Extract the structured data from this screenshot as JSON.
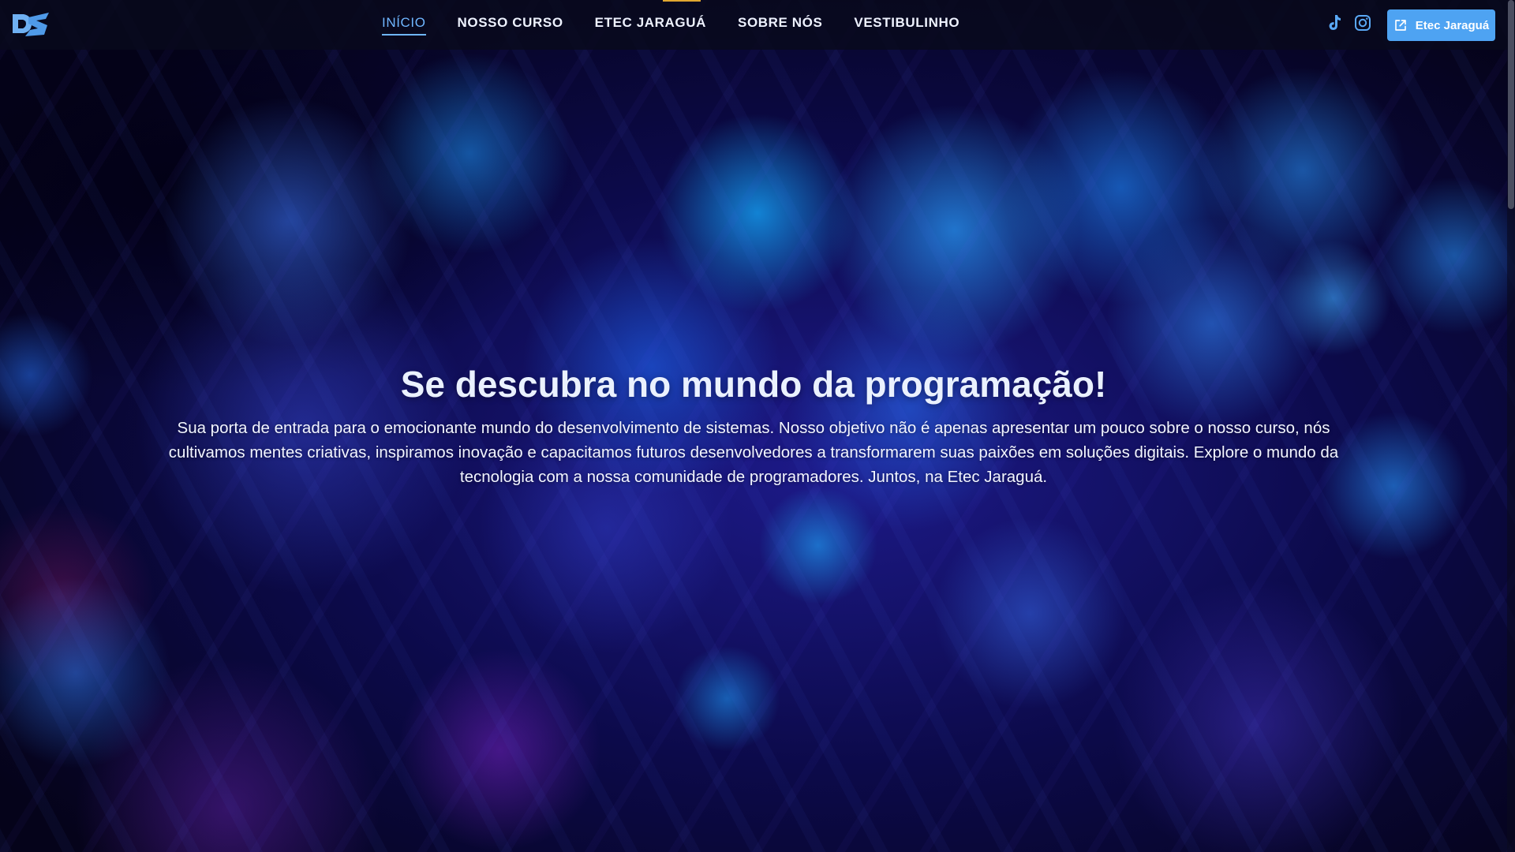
{
  "nav": {
    "items": [
      {
        "label": "INÍCIO",
        "active": true
      },
      {
        "label": "NOSSO CURSO",
        "active": false
      },
      {
        "label": "ETEC JARAGUÁ",
        "active": false
      },
      {
        "label": "SOBRE NÓS",
        "active": false
      },
      {
        "label": "VESTIBULINHO",
        "active": false
      }
    ]
  },
  "social": {
    "icons": [
      "tiktok-icon",
      "instagram-icon"
    ]
  },
  "cta": {
    "label": "Etec Jaraguá",
    "icon": "external-link-icon"
  },
  "hero": {
    "title": "Se descubra no mundo da programação!",
    "text": "Sua porta de entrada para o emocionante mundo do desenvolvimento de sistemas. Nosso objetivo não é apenas apresentar um pouco sobre o nosso curso, nós cultivamos mentes criativas, inspiramos inovação e capacitamos futuros desenvolvedores a transformarem suas paixões em soluções digitais. Explore o mundo da tecnologia com a nossa comunidade de programadores. Juntos, na Etec Jaraguá."
  },
  "colors": {
    "accent": "#4ea3f2",
    "nav_active": "#6fb6ff",
    "top_accent": "#e0a730",
    "navbar_bg": "#080a1c"
  }
}
